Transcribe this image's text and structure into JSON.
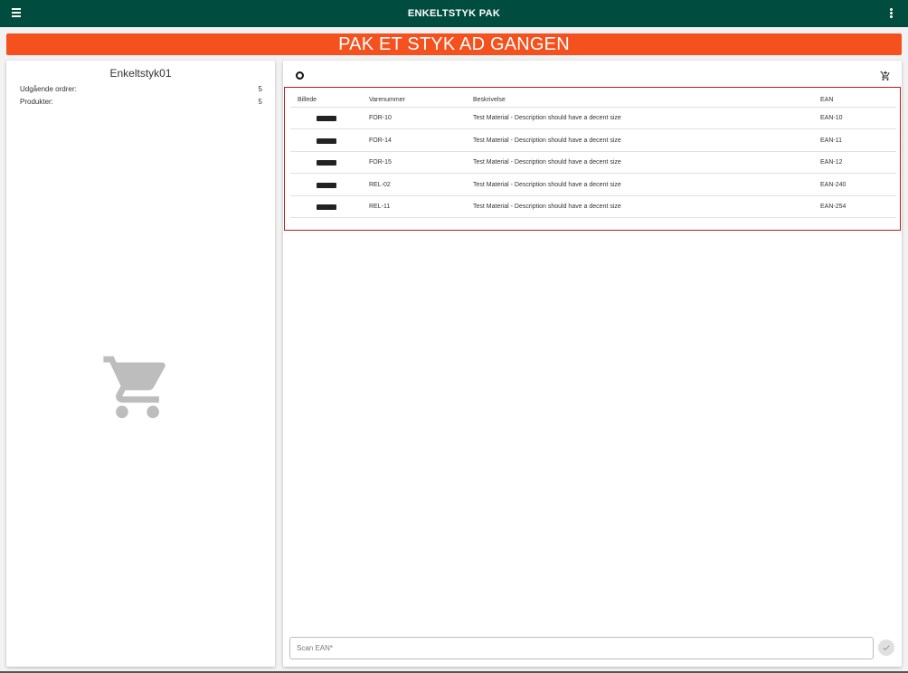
{
  "header": {
    "title": "ENKELTSTYK PAK"
  },
  "banner": {
    "text": "PAK ET STYK AD GANGEN"
  },
  "station": {
    "name": "Enkeltstyk01",
    "stats": [
      {
        "label": "Udgående ordrer:",
        "value": "5"
      },
      {
        "label": "Produkter:",
        "value": "5"
      }
    ]
  },
  "table": {
    "columns": [
      "Billede",
      "Varenummer",
      "Beskrivelse",
      "EAN"
    ],
    "rows": [
      {
        "sku": "FOR-10",
        "description": "Test Material - Description should have a decent size",
        "ean": "EAN-10"
      },
      {
        "sku": "FOR-14",
        "description": "Test Material - Description should have a decent size",
        "ean": "EAN-11"
      },
      {
        "sku": "FOR-15",
        "description": "Test Material - Description should have a decent size",
        "ean": "EAN-12"
      },
      {
        "sku": "REL-02",
        "description": "Test Material - Description should have a decent size",
        "ean": "EAN-240"
      },
      {
        "sku": "REL-11",
        "description": "Test Material - Description should have a decent size",
        "ean": "EAN-254"
      }
    ]
  },
  "scan": {
    "placeholder": "Scan EAN*",
    "value": ""
  },
  "icons": {
    "menu": "menu-icon",
    "more": "more-vert-icon",
    "empty_cart": "shopping-cart-icon",
    "record": "circle-icon",
    "add_to_cart": "add-shopping-cart-icon",
    "confirm": "check-icon"
  },
  "colors": {
    "header": "#004d40",
    "banner": "#f4511e",
    "table_border": "#b71c1c"
  }
}
